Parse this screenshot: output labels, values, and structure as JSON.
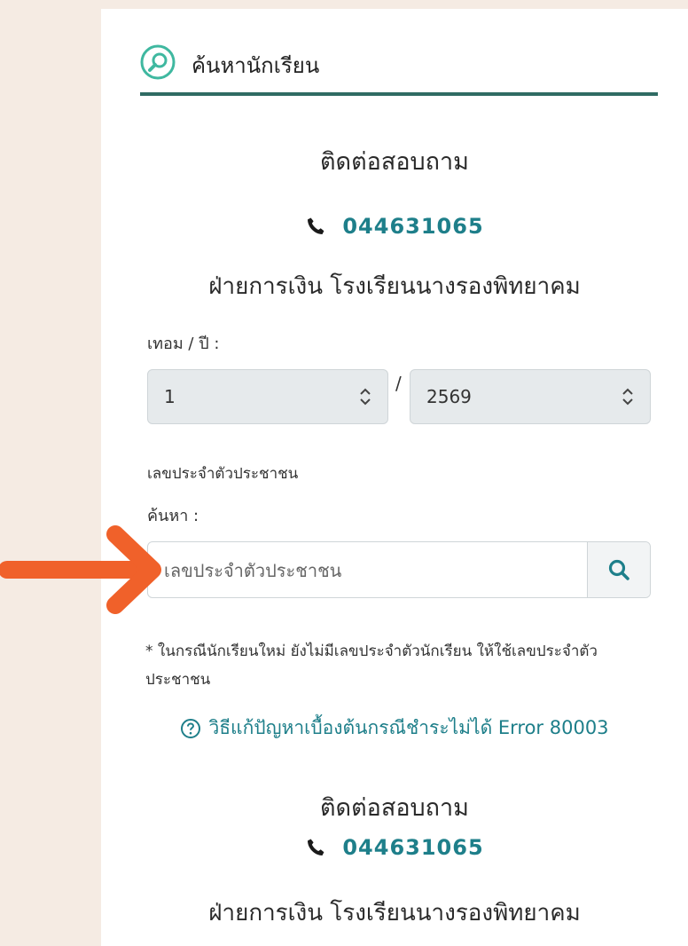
{
  "header": {
    "title": "ค้นหานักเรียน",
    "icon": "search-icon",
    "accent": "#2f6b63"
  },
  "contact_top": {
    "heading": "ติดต่อสอบถาม",
    "phone": "044631065",
    "department": "ฝ่ายการเงิน โรงเรียนนางรองพิทยาคม"
  },
  "term_year": {
    "label": "เทอม / ปี :",
    "term_value": "1",
    "separator": "/",
    "year_value": "2569"
  },
  "search": {
    "section_label": "เลขประจำตัวประชาชน",
    "label": "ค้นหา :",
    "placeholder": "เลขประจำตัวประชาชน"
  },
  "note": "* ในกรณีนักเรียนใหม่ ยังไม่มีเลขประจำตัวนักเรียน ให้ใช้เลขประจำตัวประชาชน",
  "help_link": "วิธีแก้ปัญหาเบื้องต้นกรณีชำระไม่ได้ Error 80003",
  "contact_bottom": {
    "heading": "ติดต่อสอบถาม",
    "phone": "044631065",
    "department": "ฝ่ายการเงิน โรงเรียนนางรองพิทยาคม"
  },
  "colors": {
    "link": "#1e7f8a",
    "arrow": "#f0612a",
    "background": "#f5ebe3"
  }
}
